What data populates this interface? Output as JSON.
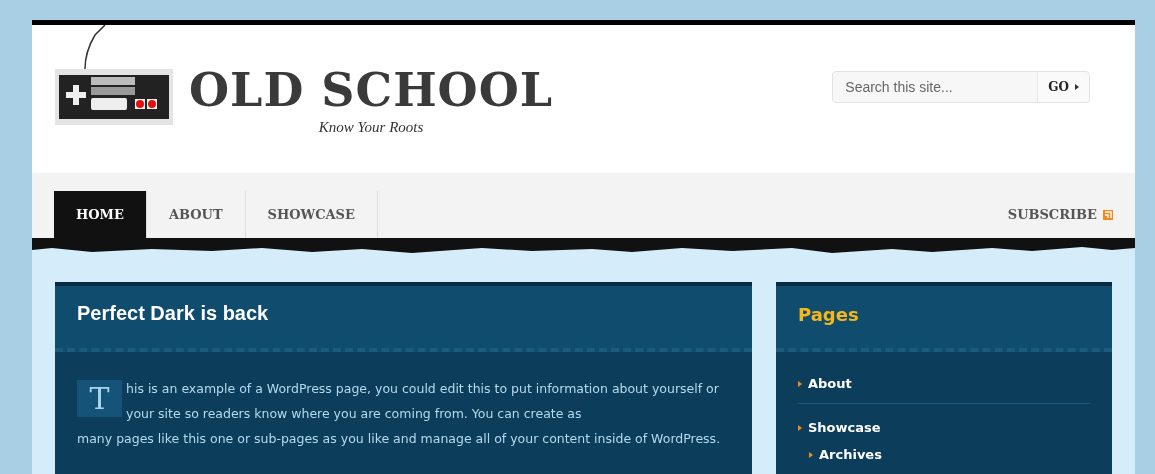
{
  "header": {
    "logo_title": "OLD SCHOOL",
    "tagline": "Know Your Roots",
    "search": {
      "placeholder": "Search this site...",
      "button": "GO"
    }
  },
  "nav": {
    "tabs": [
      {
        "label": "HOME",
        "selected": true
      },
      {
        "label": "ABOUT",
        "selected": false
      },
      {
        "label": "SHOWCASE",
        "selected": false
      }
    ],
    "subscribe": "SUBSCRIBE"
  },
  "post": {
    "title": "Perfect Dark is back",
    "drop_cap": "T",
    "text_beside_cap": "his is an example of a WordPress page, you could edit this to put information about yourself or your site so readers know where you are coming from. You can create as",
    "text_below_cap": "many pages like this one or sub-pages as you like and manage all of your content inside of WordPress."
  },
  "sidebar": {
    "title": "Pages",
    "items": [
      {
        "label": "About"
      },
      {
        "label": "Showcase",
        "children": [
          {
            "label": "Archives"
          }
        ]
      }
    ]
  }
}
